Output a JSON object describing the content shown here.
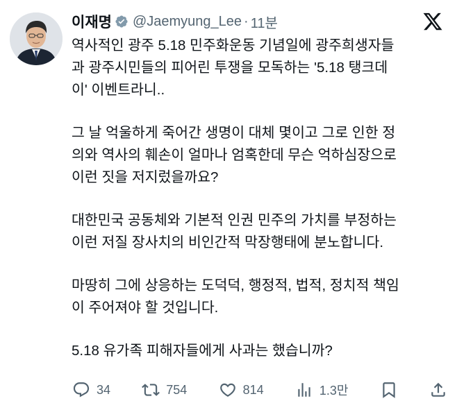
{
  "author": {
    "name": "이재명",
    "handle": "@Jaemyung_Lee",
    "separator": "·",
    "time": "11분",
    "verified": true,
    "avatar": "politician-portrait"
  },
  "platform_icon": "x-logo",
  "tweet": {
    "paragraphs": [
      [
        "역사적인 광주 5.18 민주화운동 기념일에 광주희생자들",
        "과 광주시민들의 피어린 투쟁을 모독하는 '5.18 탱크데",
        "이' 이벤트라니.."
      ],
      [
        "그 날 억울하게 죽어간 생명이 대체 몇이고 그로 인한 정",
        "의와 역사의 훼손이 얼마나 엄혹한데 무슨 억하심장으로",
        "이런 짓을 저지렀을까요?"
      ],
      [
        "대한민국 공동체와 기본적 인권 민주의 가치를 부정하는",
        "이런 저질 장사치의 비인간적 막장행태에 분노합니다."
      ],
      [
        "마땅히 그에 상응하는 도덕덕, 행정적, 법적, 정치적 책임",
        "이 주어져야 할 것입니다."
      ],
      [
        "5.18 유가족 피해자들에게 사과는 했습니까?"
      ]
    ]
  },
  "actions": {
    "replies": "34",
    "reposts": "754",
    "likes": "814",
    "views": "1.3만",
    "icons": [
      "reply-icon",
      "repost-icon",
      "like-icon",
      "views-icon",
      "bookmark-icon",
      "share-icon"
    ]
  },
  "colors": {
    "text": "#0f1419",
    "secondary": "#536471",
    "verified_badge": "#829aab"
  }
}
